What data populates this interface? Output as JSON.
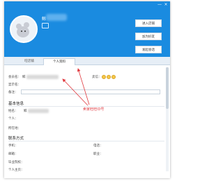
{
  "header": {
    "nickname_prefix": "鲸",
    "win_minimize": "—",
    "win_close": "×",
    "buttons": [
      {
        "label": "进入店铺"
      },
      {
        "label": "加为好友"
      },
      {
        "label": "发起会话"
      }
    ]
  },
  "tabs": [
    {
      "label": "旺店铺"
    },
    {
      "label": "个人资料"
    }
  ],
  "profile": {
    "member_label": "会员名：",
    "member_value_prefix": "鲸",
    "buyer_credit_label": "卖信：",
    "display_label": "显示名：",
    "note_label": "备注：",
    "basic_info_title": "基本信息",
    "name_label": "姓名：",
    "name_value_prefix": "鲸",
    "person_label": "个人：",
    "location_label": "所在地：",
    "contact_title": "联系方式",
    "mobile_label": "手机：",
    "phone_label": "电话：",
    "email_label": "邮箱：",
    "job_label": "职业：",
    "school_label": "毕业院校：",
    "homepage_label": "个人主页："
  },
  "annotation": "卖家旺旺ID号",
  "colors": {
    "header": "#1a8be0",
    "annotation": "#e0383e"
  }
}
